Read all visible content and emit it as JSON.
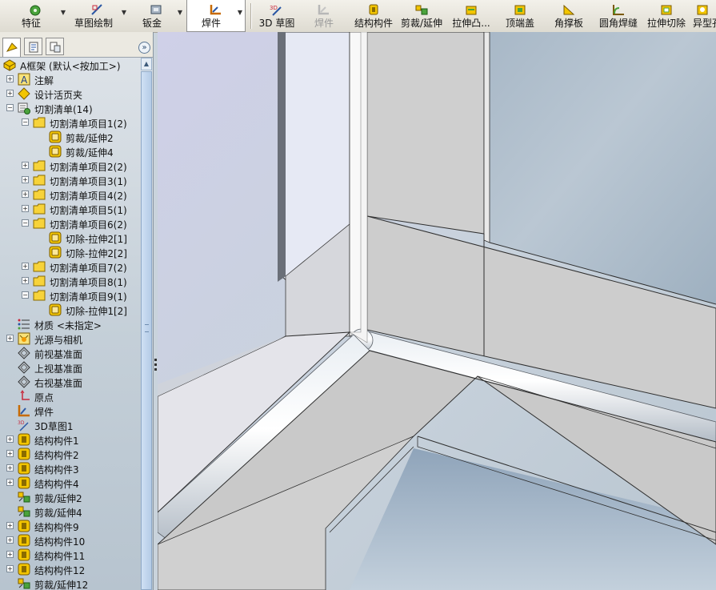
{
  "toolbar": {
    "items": [
      {
        "label": "特征",
        "icon": "features-icon"
      },
      {
        "label": "草图绘制",
        "icon": "sketch-icon"
      },
      {
        "label": "钣金",
        "icon": "sheet-metal-icon"
      },
      {
        "label": "焊件",
        "icon": "weldments-icon"
      },
      {
        "label": "3D 草图",
        "icon": "3d-sketch-icon"
      },
      {
        "label": "焊件",
        "icon": "weldment-icon"
      },
      {
        "label": "结构构件",
        "icon": "structural-member-icon"
      },
      {
        "label": "剪裁/延伸",
        "icon": "trim-extend-icon"
      },
      {
        "label": "拉伸凸...",
        "icon": "extruded-boss-icon"
      },
      {
        "label": "顶端盖",
        "icon": "end-cap-icon"
      },
      {
        "label": "角撑板",
        "icon": "gusset-icon"
      },
      {
        "label": "圆角焊缝",
        "icon": "fillet-bead-icon"
      },
      {
        "label": "拉伸切除",
        "icon": "extruded-cut-icon"
      },
      {
        "label": "异型孔",
        "icon": "hole-wizard-icon"
      }
    ]
  },
  "tree": {
    "root": "A框架  (默认<按加工>)",
    "items": [
      {
        "label": "注解",
        "icon": "annotations-icon"
      },
      {
        "label": "设计活页夹",
        "icon": "design-binder-icon"
      },
      {
        "label": "切割清单(14)",
        "icon": "cut-list-icon"
      },
      {
        "label": "切割清单项目1(2)",
        "icon": "folder-icon"
      },
      {
        "label": "剪裁/延伸2",
        "icon": "solid-body-icon"
      },
      {
        "label": "剪裁/延伸4",
        "icon": "solid-body-icon"
      },
      {
        "label": "切割清单项目2(2)",
        "icon": "folder-icon"
      },
      {
        "label": "切割清单项目3(1)",
        "icon": "folder-icon"
      },
      {
        "label": "切割清单项目4(2)",
        "icon": "folder-icon"
      },
      {
        "label": "切割清单项目5(1)",
        "icon": "folder-icon"
      },
      {
        "label": "切割清单项目6(2)",
        "icon": "folder-icon"
      },
      {
        "label": "切除-拉伸2[1]",
        "icon": "solid-body-icon"
      },
      {
        "label": "切除-拉伸2[2]",
        "icon": "solid-body-icon"
      },
      {
        "label": "切割清单项目7(2)",
        "icon": "folder-icon"
      },
      {
        "label": "切割清单项目8(1)",
        "icon": "folder-icon"
      },
      {
        "label": "切割清单项目9(1)",
        "icon": "folder-icon"
      },
      {
        "label": "切除-拉伸1[2]",
        "icon": "solid-body-icon"
      },
      {
        "label": "材质 <未指定>",
        "icon": "material-icon"
      },
      {
        "label": "光源与相机",
        "icon": "lights-cameras-icon"
      },
      {
        "label": "前视基准面",
        "icon": "plane-icon"
      },
      {
        "label": "上视基准面",
        "icon": "plane-icon"
      },
      {
        "label": "右视基准面",
        "icon": "plane-icon"
      },
      {
        "label": "原点",
        "icon": "origin-icon"
      },
      {
        "label": "焊件",
        "icon": "weldment-feature-icon"
      },
      {
        "label": "3D草图1",
        "icon": "3d-sketch-feature-icon"
      },
      {
        "label": "结构构件1",
        "icon": "structural-member-feature-icon"
      },
      {
        "label": "结构构件2",
        "icon": "structural-member-feature-icon"
      },
      {
        "label": "结构构件3",
        "icon": "structural-member-feature-icon"
      },
      {
        "label": "结构构件4",
        "icon": "structural-member-feature-icon"
      },
      {
        "label": "剪裁/延伸2",
        "icon": "trim-extend-feature-icon"
      },
      {
        "label": "剪裁/延伸4",
        "icon": "trim-extend-feature-icon"
      },
      {
        "label": "结构构件9",
        "icon": "structural-member-feature-icon"
      },
      {
        "label": "结构构件10",
        "icon": "structural-member-feature-icon"
      },
      {
        "label": "结构构件11",
        "icon": "structural-member-feature-icon"
      },
      {
        "label": "结构构件12",
        "icon": "structural-member-feature-icon"
      },
      {
        "label": "剪裁/延伸12",
        "icon": "trim-extend-feature-icon"
      }
    ]
  },
  "panel": {
    "tabs": [
      "featuremanager-tab",
      "propertymanager-tab",
      "configurationmanager-tab"
    ],
    "expand_label": "»"
  },
  "colors": {
    "accent": "#1f5fa8",
    "folder": "#f2c500",
    "toolbar_bg": "#e8e5dc",
    "viewport_bg": "#b7c6d4"
  }
}
